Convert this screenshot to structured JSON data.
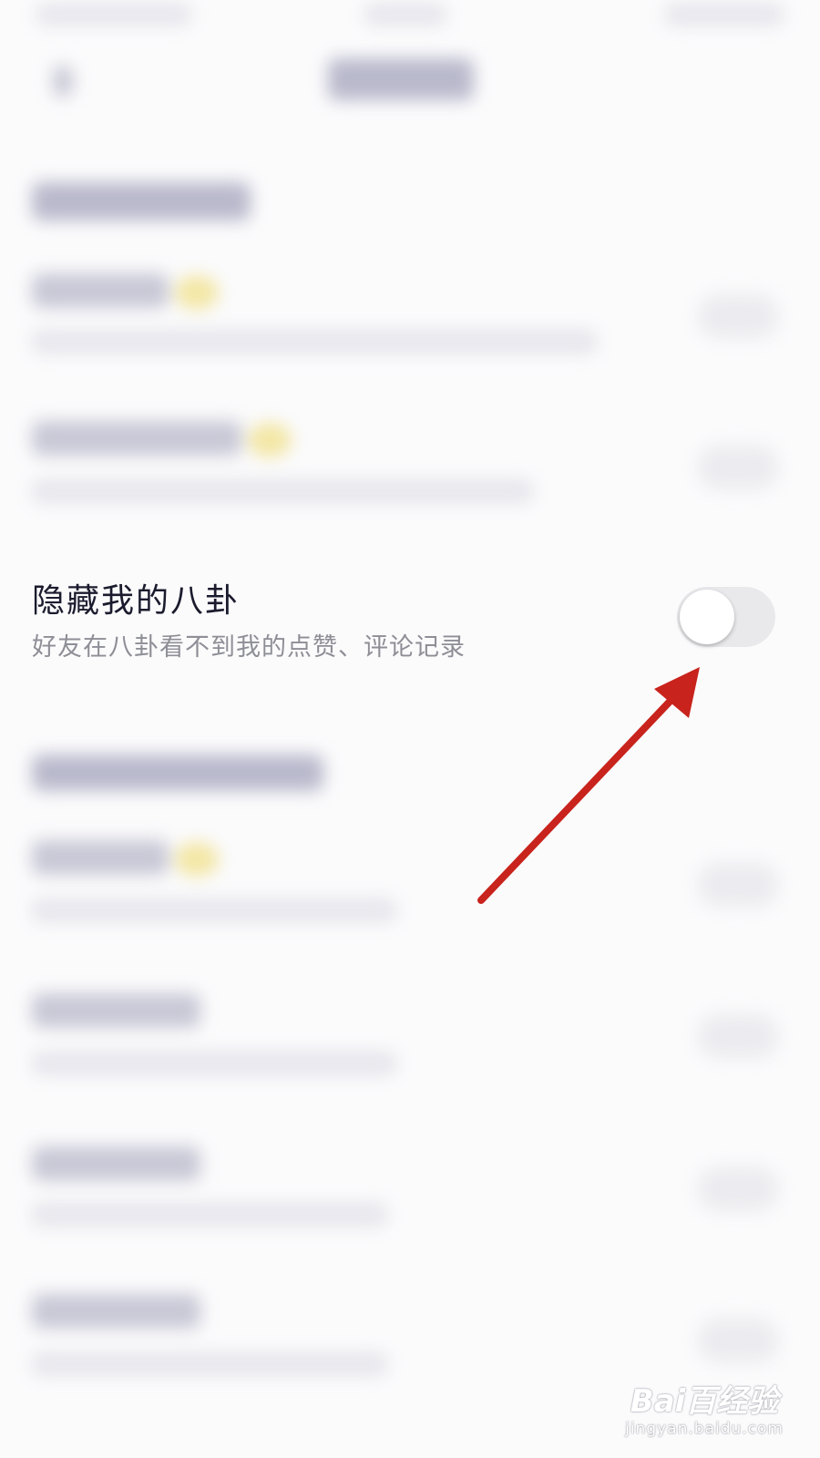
{
  "setting": {
    "title": "隐藏我的八卦",
    "subtitle": "好友在八卦看不到我的点赞、评论记录",
    "toggle_state": "off"
  },
  "watermark": {
    "logo_text": "Bai百经验",
    "url": "jingyan.baidu.com"
  },
  "colors": {
    "annotation_arrow": "#c8231c",
    "title_text": "#1b1b2e",
    "subtitle_text": "#8e8e96",
    "toggle_track": "#e9e9ec"
  },
  "icons": {
    "annotation": "red-arrow-icon",
    "back": "back-arrow-icon"
  }
}
